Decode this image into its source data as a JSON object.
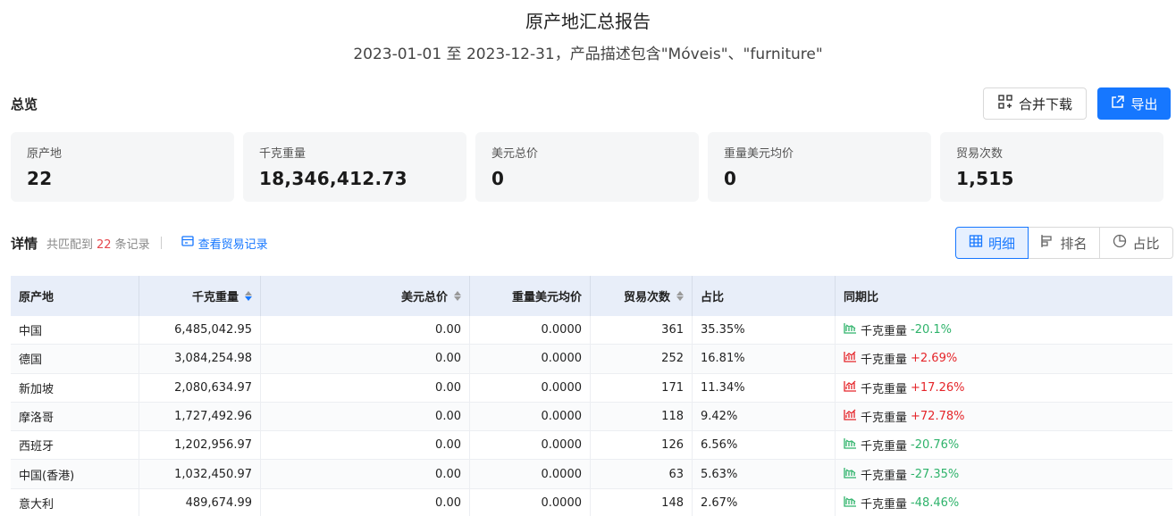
{
  "header": {
    "title": "原产地汇总报告",
    "subtitle": "2023-01-01 至 2023-12-31，产品描述包含\"Móveis\"、\"furniture\""
  },
  "overview": {
    "label": "总览",
    "merge_download": "合并下载",
    "export": "导出",
    "cards": [
      {
        "label": "原产地",
        "value": "22"
      },
      {
        "label": "千克重量",
        "value": "18,346,412.73"
      },
      {
        "label": "美元总价",
        "value": "0"
      },
      {
        "label": "重量美元均价",
        "value": "0"
      },
      {
        "label": "贸易次数",
        "value": "1,515"
      }
    ]
  },
  "detail": {
    "label": "详情",
    "count_prefix": "共匹配到",
    "count": "22",
    "count_suffix": "条记录",
    "view_records": "查看贸易记录",
    "views": [
      "明细",
      "排名",
      "占比"
    ]
  },
  "table": {
    "columns": [
      "原产地",
      "千克重量",
      "美元总价",
      "重量美元均价",
      "贸易次数",
      "占比",
      "同期比"
    ],
    "rows": [
      {
        "origin": "中国",
        "kg": "6,485,042.95",
        "usd": "0.00",
        "avg": "0.0000",
        "trades": "361",
        "share": "35.35%",
        "yoy_metric": "千克重量",
        "yoy": "-20.1%",
        "trend": "down"
      },
      {
        "origin": "德国",
        "kg": "3,084,254.98",
        "usd": "0.00",
        "avg": "0.0000",
        "trades": "252",
        "share": "16.81%",
        "yoy_metric": "千克重量",
        "yoy": "+2.69%",
        "trend": "up"
      },
      {
        "origin": "新加坡",
        "kg": "2,080,634.97",
        "usd": "0.00",
        "avg": "0.0000",
        "trades": "171",
        "share": "11.34%",
        "yoy_metric": "千克重量",
        "yoy": "+17.26%",
        "trend": "up"
      },
      {
        "origin": "摩洛哥",
        "kg": "1,727,492.96",
        "usd": "0.00",
        "avg": "0.0000",
        "trades": "118",
        "share": "9.42%",
        "yoy_metric": "千克重量",
        "yoy": "+72.78%",
        "trend": "up"
      },
      {
        "origin": "西班牙",
        "kg": "1,202,956.97",
        "usd": "0.00",
        "avg": "0.0000",
        "trades": "126",
        "share": "6.56%",
        "yoy_metric": "千克重量",
        "yoy": "-20.76%",
        "trend": "down"
      },
      {
        "origin": "中国(香港)",
        "kg": "1,032,450.97",
        "usd": "0.00",
        "avg": "0.0000",
        "trades": "63",
        "share": "5.63%",
        "yoy_metric": "千克重量",
        "yoy": "-27.35%",
        "trend": "down"
      },
      {
        "origin": "意大利",
        "kg": "489,674.99",
        "usd": "0.00",
        "avg": "0.0000",
        "trades": "148",
        "share": "2.67%",
        "yoy_metric": "千克重量",
        "yoy": "-48.46%",
        "trend": "down"
      }
    ]
  },
  "colors": {
    "accent": "#1677ff",
    "positive": "#e5252a",
    "negative": "#2fb36b",
    "header_bg": "#e8eef9"
  }
}
